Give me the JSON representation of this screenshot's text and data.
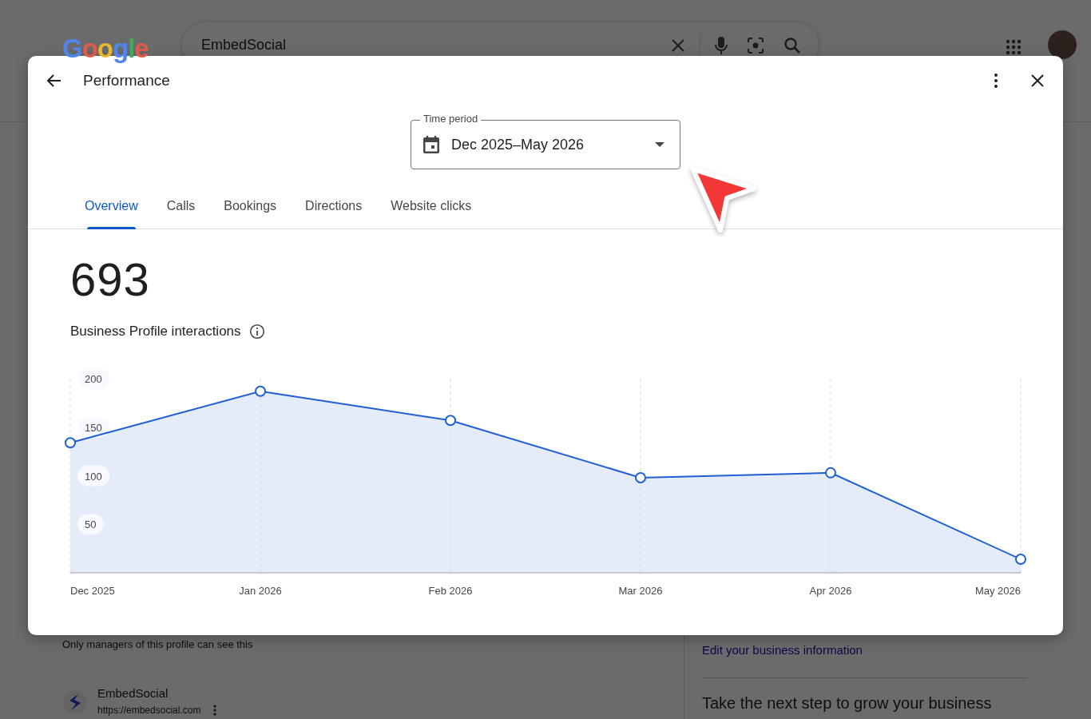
{
  "page": {
    "logo": "Google",
    "search": {
      "value": "EmbedSocial"
    },
    "notice": "Only managers of this profile can see this",
    "business": {
      "name": "EmbedSocial",
      "url": "https://embedsocial.com"
    },
    "side_link": "Edit your business information",
    "side_heading": "Take the next step to grow your business"
  },
  "dialog": {
    "title": "Performance",
    "time_period": {
      "label": "Time period",
      "value": "Dec 2025–May 2026"
    },
    "tabs": [
      {
        "label": "Overview",
        "selected": true
      },
      {
        "label": "Calls",
        "selected": false
      },
      {
        "label": "Bookings",
        "selected": false
      },
      {
        "label": "Directions",
        "selected": false
      },
      {
        "label": "Website clicks",
        "selected": false
      }
    ],
    "total": "693",
    "metric_label": "Business Profile interactions",
    "chart_data": {
      "type": "area",
      "categories": [
        "Dec 2025",
        "Jan 2026",
        "Feb 2026",
        "Mar 2026",
        "Apr 2026",
        "May 2026"
      ],
      "series": [
        {
          "color": "#1f5fd6",
          "values": [
            134,
            187,
            157,
            98,
            103,
            14
          ]
        }
      ],
      "ylim": [
        0,
        200
      ],
      "yticks": [
        50,
        100,
        150,
        200
      ],
      "grid": true
    }
  }
}
